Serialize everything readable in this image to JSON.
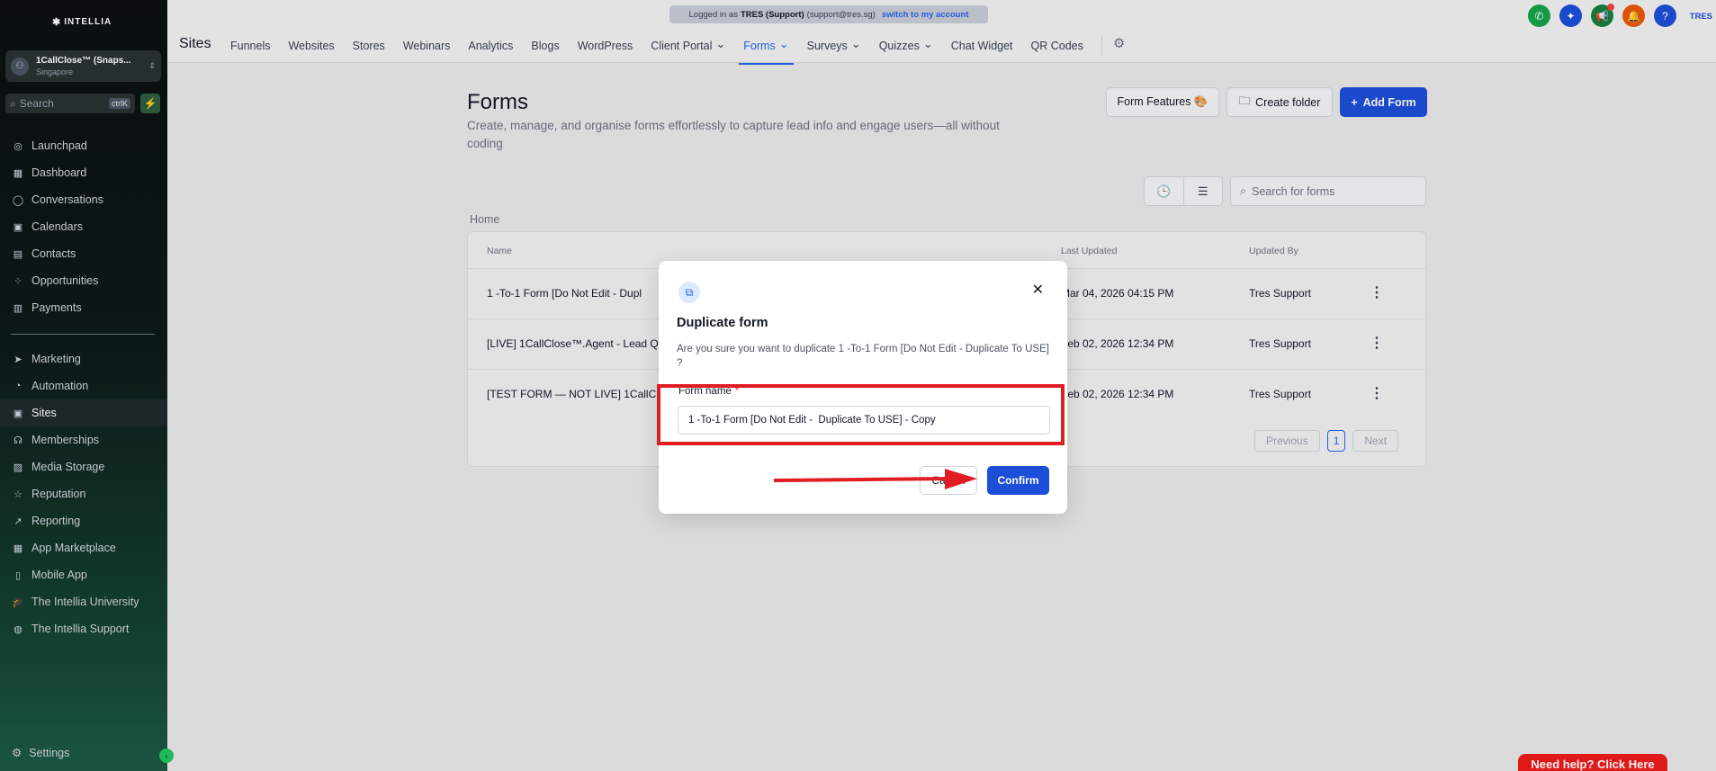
{
  "brand": {
    "name": "INTELLIA"
  },
  "account": {
    "name": "1CallClose™ (Snaps...",
    "location": "Singapore"
  },
  "sidebar_search": {
    "placeholder": "Search",
    "shortcut": "ctrlK"
  },
  "sidebar": {
    "top": [
      {
        "label": "Launchpad",
        "icon": "launchpad-icon",
        "glyph": "◎"
      },
      {
        "label": "Dashboard",
        "icon": "dashboard-icon",
        "glyph": "▦"
      },
      {
        "label": "Conversations",
        "icon": "chat-icon",
        "glyph": "◯"
      },
      {
        "label": "Calendars",
        "icon": "calendar-icon",
        "glyph": "▣"
      },
      {
        "label": "Contacts",
        "icon": "contacts-icon",
        "glyph": "▤"
      },
      {
        "label": "Opportunities",
        "icon": "opportunities-icon",
        "glyph": "⁘"
      },
      {
        "label": "Payments",
        "icon": "payments-icon",
        "glyph": "▥"
      }
    ],
    "bottom": [
      {
        "label": "Marketing",
        "icon": "marketing-icon",
        "glyph": "➤"
      },
      {
        "label": "Automation",
        "icon": "automation-icon",
        "glyph": "◔"
      },
      {
        "label": "Sites",
        "icon": "sites-icon",
        "glyph": "▣",
        "active": true
      },
      {
        "label": "Memberships",
        "icon": "memberships-icon",
        "glyph": "☊"
      },
      {
        "label": "Media Storage",
        "icon": "media-icon",
        "glyph": "▨"
      },
      {
        "label": "Reputation",
        "icon": "star-icon",
        "glyph": "☆"
      },
      {
        "label": "Reporting",
        "icon": "reporting-icon",
        "glyph": "↗"
      },
      {
        "label": "App Marketplace",
        "icon": "marketplace-icon",
        "glyph": "▦"
      },
      {
        "label": "Mobile App",
        "icon": "mobile-icon",
        "glyph": "▯"
      },
      {
        "label": "The Intellia University",
        "icon": "university-icon",
        "glyph": "🎓"
      },
      {
        "label": "The Intellia Support",
        "icon": "support-icon",
        "glyph": "◍"
      }
    ],
    "settings": "Settings"
  },
  "banner": {
    "prefix": "Logged in as",
    "user": "TRES (Support)",
    "email": "(support@tres.sg)",
    "switch": "switch to my account"
  },
  "header": {
    "title": "Sites",
    "tabs": [
      {
        "label": "Funnels"
      },
      {
        "label": "Websites"
      },
      {
        "label": "Stores"
      },
      {
        "label": "Webinars"
      },
      {
        "label": "Analytics"
      },
      {
        "label": "Blogs"
      },
      {
        "label": "WordPress"
      },
      {
        "label": "Client Portal",
        "dropdown": true
      },
      {
        "label": "Forms",
        "dropdown": true,
        "active": true
      },
      {
        "label": "Surveys",
        "dropdown": true
      },
      {
        "label": "Quizzes",
        "dropdown": true
      },
      {
        "label": "Chat Widget"
      },
      {
        "label": "QR Codes"
      }
    ],
    "user_label": "TRES",
    "circle_colors": [
      "#16a34a",
      "#1d4ed8",
      "#15803d",
      "#ea580c",
      "#1d4ed8"
    ]
  },
  "page": {
    "title": "Forms",
    "description": "Create, manage, and organise forms effortlessly to capture lead info and engage users—all without coding",
    "form_features": "Form Features 🎨",
    "create_folder": "Create folder",
    "add_form": "Add Form",
    "search_placeholder": "Search for forms",
    "breadcrumb": "Home"
  },
  "table": {
    "columns": [
      "Name",
      "Last Updated",
      "Updated By"
    ],
    "rows": [
      {
        "name": "1 -To-1 Form [Do Not Edit -  Dupl",
        "updated": "Mar 04, 2026 04:15 PM",
        "by": "Tres Support"
      },
      {
        "name": "[LIVE] 1CallClose™.Agent - Lead Q",
        "updated": "Feb 02, 2026 12:34 PM",
        "by": "Tres Support"
      },
      {
        "name": "[TEST FORM — NOT LIVE] 1CallCl",
        "updated": "Feb 02, 2026 12:34 PM",
        "by": "Tres Support"
      }
    ],
    "pagination": {
      "previous": "Previous",
      "current": "1",
      "next": "Next"
    }
  },
  "modal": {
    "title": "Duplicate form",
    "description": "Are you sure you want to duplicate 1 -To-1 Form [Do Not Edit -  Duplicate To USE] ?",
    "field_label": "Form name",
    "required_mark": "*",
    "field_value": "1 -To-1 Form [Do Not Edit -  Duplicate To USE] - Copy",
    "cancel": "Cancel",
    "confirm": "Confirm"
  },
  "help_button": "Need help? Click Here",
  "annotation_color": "#e11d24"
}
